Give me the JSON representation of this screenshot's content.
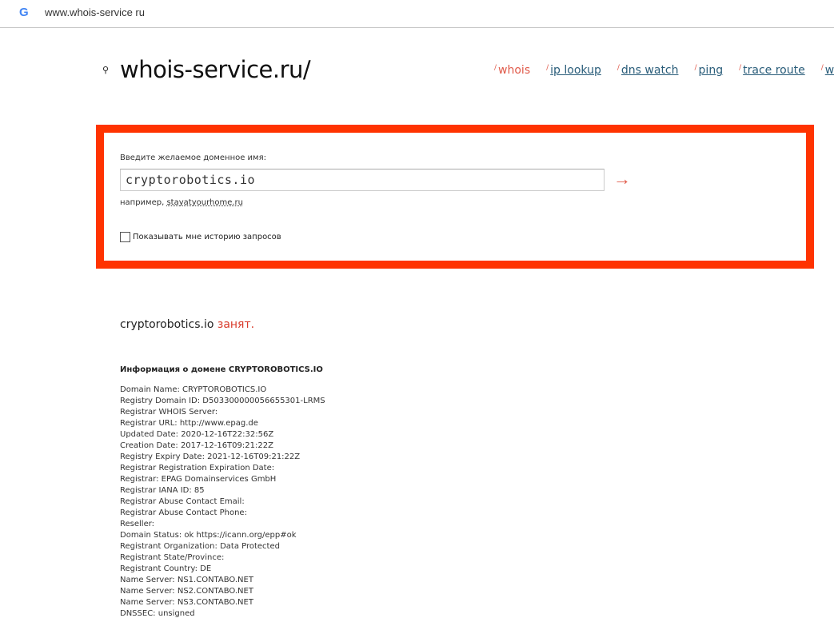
{
  "browser": {
    "url": "www.whois-service ru"
  },
  "header": {
    "logo": "whois-service.ru/",
    "nav": [
      {
        "label": "whois",
        "active": true
      },
      {
        "label": "ip lookup"
      },
      {
        "label": "dns watch"
      },
      {
        "label": "ping"
      },
      {
        "label": "trace route"
      },
      {
        "label": "wha"
      }
    ]
  },
  "form": {
    "label": "Введите желаемое доменное имя:",
    "value": "cryptorobotics.io",
    "submit": "→",
    "example_prefix": "например,",
    "example_link": "stayatyourhome.ru",
    "history_label": "Показывать мне историю запросов"
  },
  "result": {
    "domain": "cryptorobotics.io",
    "status": "занят.",
    "info_title": "Информация о домене CRYPTOROBOTICS.IO",
    "lines": [
      "Domain Name: CRYPTOROBOTICS.IO",
      "Registry Domain ID: D503300000056655301-LRMS",
      "Registrar WHOIS Server:",
      "Registrar URL: http://www.epag.de",
      "Updated Date: 2020-12-16T22:32:56Z",
      "Creation Date: 2017-12-16T09:21:22Z",
      "Registry Expiry Date: 2021-12-16T09:21:22Z",
      "Registrar Registration Expiration Date:",
      "Registrar: EPAG Domainservices GmbH",
      "Registrar IANA ID: 85",
      "Registrar Abuse Contact Email:",
      "Registrar Abuse Contact Phone:",
      "Reseller:",
      "Domain Status: ok https://icann.org/epp#ok",
      "Registrant Organization: Data Protected",
      "Registrant State/Province:",
      "Registrant Country: DE",
      "Name Server: NS1.CONTABO.NET",
      "Name Server: NS2.CONTABO.NET",
      "Name Server: NS3.CONTABO.NET",
      "DNSSEC: unsigned"
    ]
  }
}
